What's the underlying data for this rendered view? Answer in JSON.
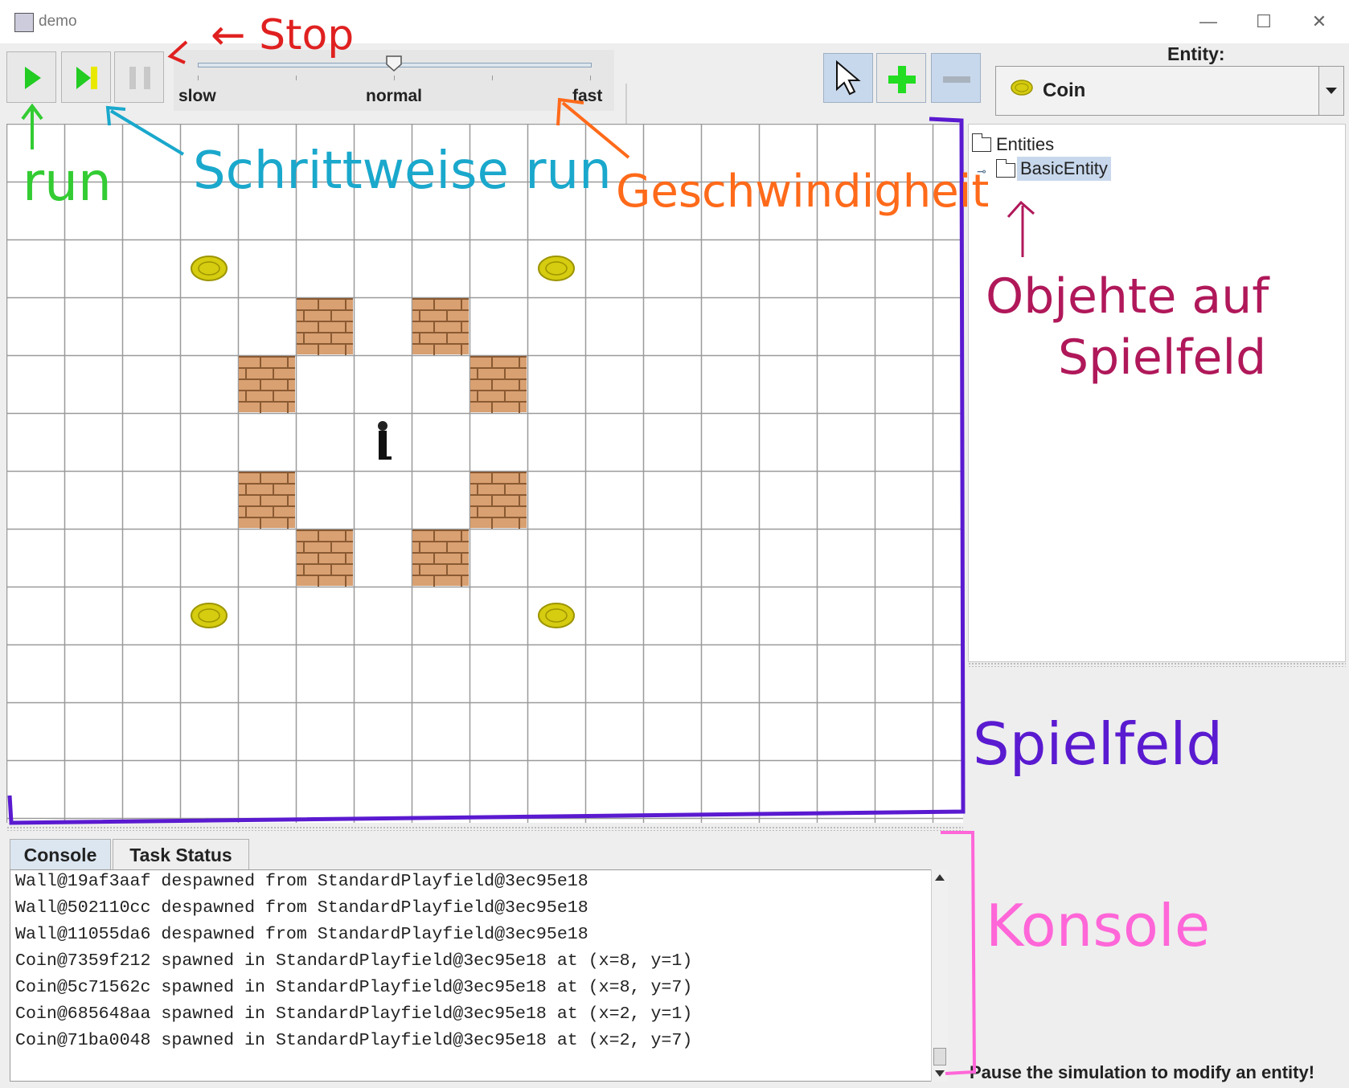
{
  "window": {
    "title": "demo",
    "minimize_icon": "minimize-icon",
    "maximize_icon": "maximize-icon",
    "close_icon": "close-icon"
  },
  "toolbar": {
    "run_icon": "play-icon",
    "step_icon": "step-icon",
    "pause_icon": "pause-icon",
    "speed": {
      "labels": {
        "slow": "slow",
        "normal": "normal",
        "fast": "fast"
      },
      "value": 0.5
    },
    "tools": [
      {
        "name": "select-tool",
        "icon": "cursor-arrow-icon",
        "selected": true
      },
      {
        "name": "add-tool",
        "icon": "plus-icon",
        "selected": false
      },
      {
        "name": "remove-tool",
        "icon": "minus-icon",
        "selected": true
      }
    ]
  },
  "entity_selector": {
    "label": "Entity:",
    "value": "Coin",
    "icon": "coin-icon"
  },
  "tree": {
    "root": {
      "label": "Entities",
      "icon": "folder-icon"
    },
    "children": [
      {
        "label": "BasicEntity",
        "icon": "folder-icon",
        "selected": true
      }
    ]
  },
  "playfield": {
    "columns": 16,
    "rows": 12,
    "walls": [
      [
        5,
        3
      ],
      [
        7,
        3
      ],
      [
        4,
        4
      ],
      [
        8,
        4
      ],
      [
        4,
        6
      ],
      [
        8,
        6
      ],
      [
        5,
        7
      ],
      [
        7,
        7
      ]
    ],
    "coins": [
      [
        3,
        2
      ],
      [
        9,
        2
      ],
      [
        3,
        8
      ],
      [
        9,
        8
      ]
    ],
    "player": [
      6,
      5
    ]
  },
  "console": {
    "tabs": [
      {
        "label": "Console",
        "active": true
      },
      {
        "label": "Task Status",
        "active": false
      }
    ],
    "lines": [
      "Wall@19af3aaf despawned from StandardPlayfield@3ec95e18",
      "Wall@502110cc despawned from StandardPlayfield@3ec95e18",
      "Wall@11055da6 despawned from StandardPlayfield@3ec95e18",
      "Coin@7359f212 spawned in StandardPlayfield@3ec95e18 at (x=8, y=1)",
      "Coin@5c71562c spawned in StandardPlayfield@3ec95e18 at (x=8, y=7)",
      "Coin@685648aa spawned in StandardPlayfield@3ec95e18 at (x=2, y=1)",
      "Coin@71ba0048 spawned in StandardPlayfield@3ec95e18 at (x=2, y=7)"
    ]
  },
  "status": {
    "hint": "Pause the simulation to modify an entity!"
  },
  "annotations": {
    "stop": "← Stop",
    "run": "run",
    "step_run": "Schrittweise run",
    "speed": "Geschwindigheit",
    "objects_line1": "Objehte auf",
    "objects_line2": "Spielfeld",
    "playfield": "Spielfeld",
    "console": "Konsole",
    "colors": {
      "stop": "#e02020",
      "run": "#33cc33",
      "step": "#1aa8cc",
      "speed": "#ff6a1a",
      "objects": "#b0185a",
      "playfield": "#5a1ad0",
      "console": "#ff66d8"
    }
  }
}
